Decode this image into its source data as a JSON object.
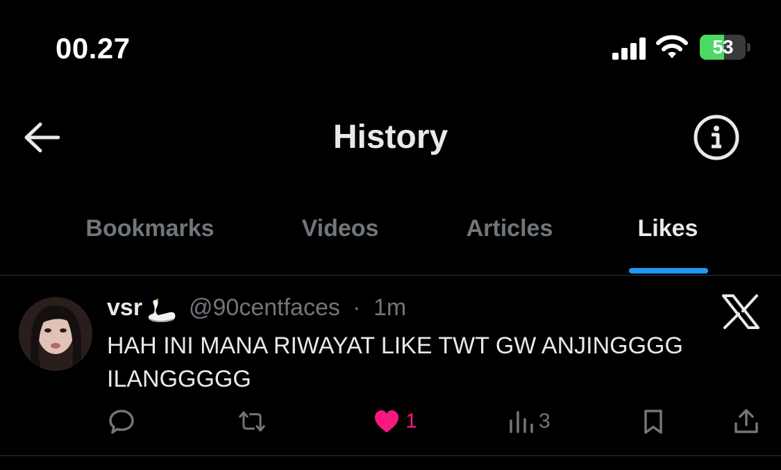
{
  "status_bar": {
    "time": "00.27",
    "battery": "53",
    "battery_level": 0.53
  },
  "header": {
    "title": "History"
  },
  "tabs": [
    {
      "label": "Bookmarks",
      "active": false
    },
    {
      "label": "Videos",
      "active": false
    },
    {
      "label": "Articles",
      "active": false
    },
    {
      "label": "Likes",
      "active": true
    }
  ],
  "tweet": {
    "name": "vsr",
    "name_emoji": "swan",
    "handle": "@90centfaces",
    "separator": "·",
    "time": "1m",
    "text": "HAH INI MANA RIWAYAT LIKE TWT GW ANJINGGGG ILANGGGGG",
    "like_count": "1",
    "views_count": "3"
  },
  "colors": {
    "accent": "#1d9bf0",
    "like": "#f91880",
    "muted": "#71767b",
    "battery": "#4cd964"
  },
  "icons": [
    "signal-icon",
    "wifi-icon",
    "battery-icon",
    "back-arrow-icon",
    "info-icon",
    "x-logo-icon",
    "reply-icon",
    "retweet-icon",
    "like-heart-icon",
    "views-icon",
    "bookmark-icon",
    "share-icon"
  ]
}
